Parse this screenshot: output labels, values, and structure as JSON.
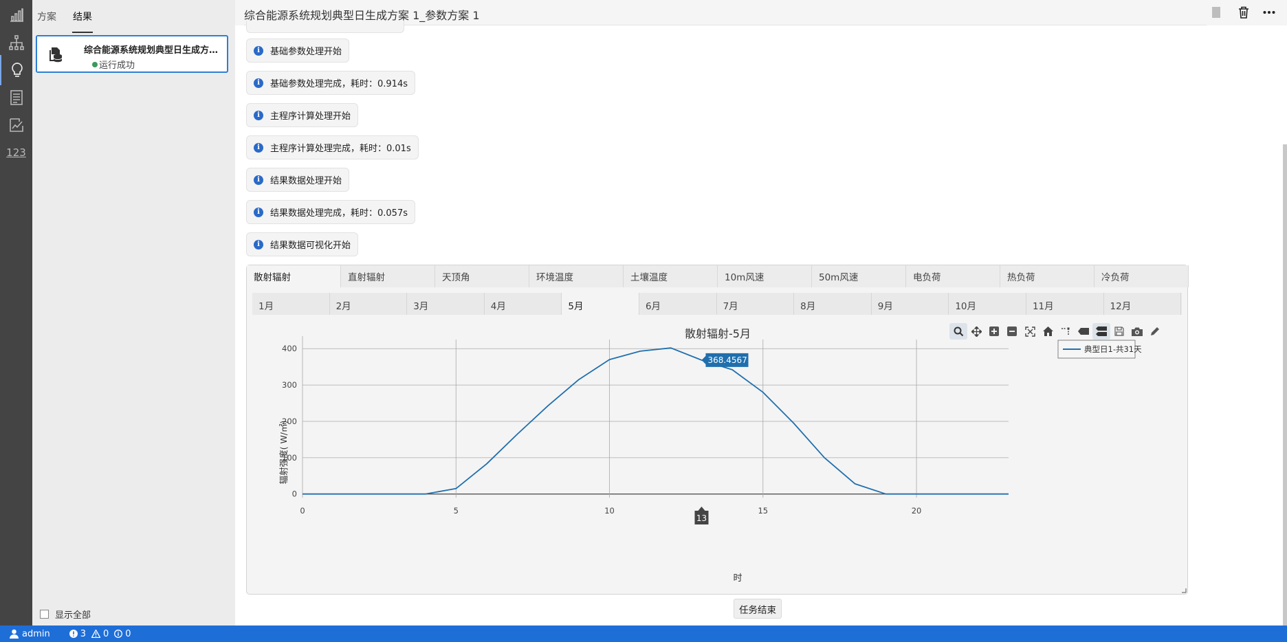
{
  "activity_bar": {
    "items": [
      {
        "name": "bar-chart-icon",
        "active": false
      },
      {
        "name": "hierarchy-icon",
        "active": false
      },
      {
        "name": "lightbulb-icon",
        "active": true
      },
      {
        "name": "document-list-icon",
        "active": false
      },
      {
        "name": "edit-chart-icon",
        "active": false
      },
      {
        "name": "numbers-icon",
        "label": "123",
        "active": false
      }
    ]
  },
  "side_panel": {
    "tabs": [
      {
        "label": "方案",
        "active": false
      },
      {
        "label": "结果",
        "active": true
      }
    ],
    "card": {
      "title": "综合能源系统规划典型日生成方案 1_参数方案 1",
      "status": "运行成功",
      "status_color": "#3a9a5a"
    },
    "show_all_label": "显示全部"
  },
  "header": {
    "title": "综合能源系统规划典型日生成方案 1_参数方案 1",
    "buttons": [
      "stop-icon",
      "trash-icon",
      "more-icon"
    ]
  },
  "log": [
    {
      "text": "基础参数处理开始"
    },
    {
      "text": "基础参数处理完成，耗时：0.914s"
    },
    {
      "text": "主程序计算处理开始"
    },
    {
      "text": "主程序计算处理完成，耗时：0.01s"
    },
    {
      "text": "结果数据处理开始"
    },
    {
      "text": "结果数据处理完成，耗时：0.057s"
    },
    {
      "text": "结果数据可视化开始"
    }
  ],
  "chart_panel": {
    "variable_tabs": [
      "散射辐射",
      "直射辐射",
      "天顶角",
      "环境温度",
      "土壤温度",
      "10m风速",
      "50m风速",
      "电负荷",
      "热负荷",
      "冷负荷"
    ],
    "variable_active": 0,
    "month_tabs": [
      "1月",
      "2月",
      "3月",
      "4月",
      "5月",
      "6月",
      "7月",
      "8月",
      "9月",
      "10月",
      "11月",
      "12月"
    ],
    "month_active": 4
  },
  "chart_data": {
    "type": "line",
    "title": "散射辐射-5月",
    "xlabel": "时",
    "ylabel": "辐射强度( W/㎡)",
    "x": [
      0,
      1,
      2,
      3,
      4,
      5,
      6,
      7,
      8,
      9,
      10,
      11,
      12,
      13,
      14,
      15,
      16,
      17,
      18,
      19,
      20,
      21,
      22,
      23
    ],
    "series": [
      {
        "name": "典型日1-共31天",
        "values": [
          0,
          0,
          0,
          0,
          0,
          15,
          83,
          165,
          243,
          315,
          370,
          393,
          402,
          368.4567,
          342,
          280,
          195,
          100,
          28,
          0,
          0,
          0,
          0,
          0
        ],
        "color": "#1f6fad"
      }
    ],
    "xlim": [
      0,
      23
    ],
    "ylim": [
      -10,
      425
    ],
    "xticks": [
      0,
      5,
      10,
      15,
      20
    ],
    "yticks": [
      0,
      100,
      200,
      300,
      400
    ],
    "grid": true,
    "legend_position": "top-right",
    "hover": {
      "x": 13,
      "x_label": "13",
      "y_label": "368.4567"
    }
  },
  "modebar_icons": [
    "zoom-icon",
    "pan-icon",
    "zoom-in-icon",
    "zoom-out-icon",
    "autoscale-icon",
    "home-icon",
    "spike-lines-icon",
    "hover-closest-icon",
    "hover-compare-icon",
    "save-icon",
    "camera-icon",
    "pencil-icon"
  ],
  "task_end_label": "任务结束",
  "status_bar": {
    "user": "admin",
    "errors": "3",
    "warnings": "0",
    "infos": "0"
  }
}
